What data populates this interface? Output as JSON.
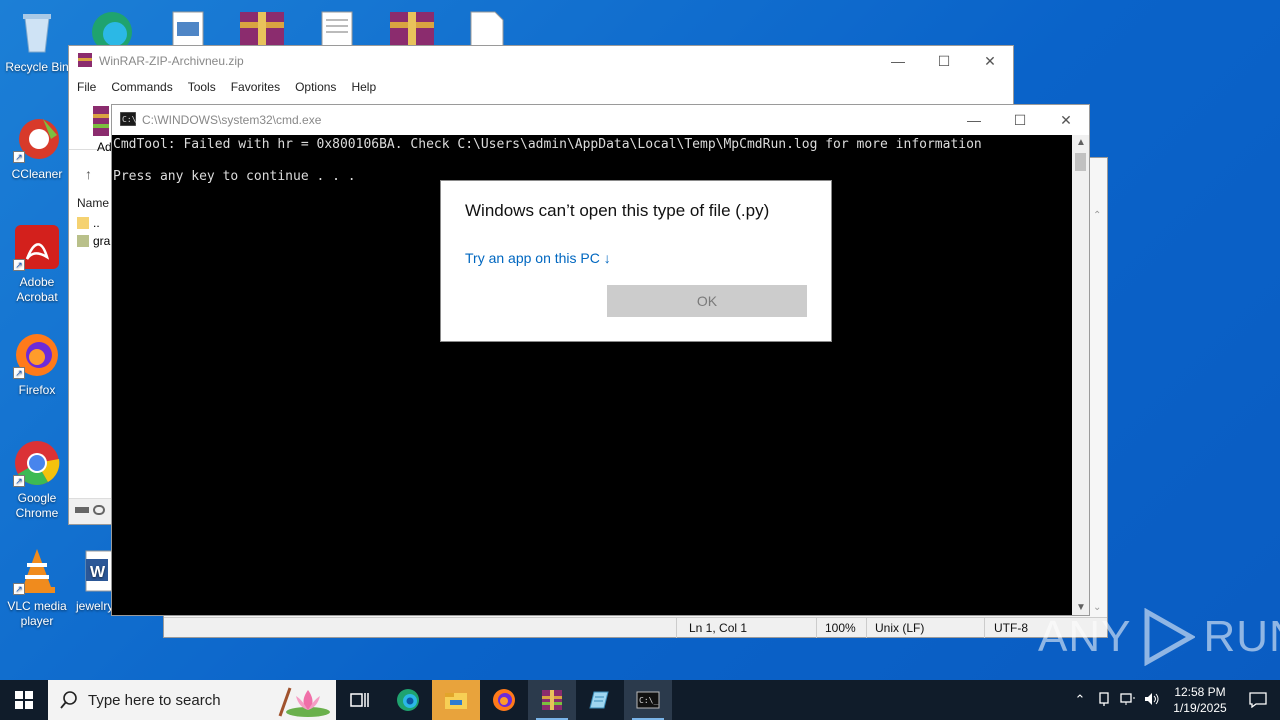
{
  "desktop_icons": [
    {
      "label": "Recycle Bin"
    },
    {
      "label": "CCleaner"
    },
    {
      "label": "Adobe Acrobat"
    },
    {
      "label": "Firefox"
    },
    {
      "label": "Google Chrome"
    },
    {
      "label": "VLC media player"
    },
    {
      "label": "jewelry"
    }
  ],
  "winrar": {
    "title": "WinRAR-ZIP-Archivneu.zip",
    "menu": [
      "File",
      "Commands",
      "Tools",
      "Favorites",
      "Options",
      "Help"
    ],
    "toolbar_label_partial": "Ad",
    "column_name": "Name",
    "rows": [
      "..",
      "gra"
    ]
  },
  "editor": {
    "status": {
      "position": "Ln 1, Col 1",
      "zoom": "100%",
      "line_endings": "Unix (LF)",
      "encoding": "UTF-8"
    }
  },
  "cmd": {
    "title": "C:\\WINDOWS\\system32\\cmd.exe",
    "lines": [
      "CmdTool: Failed with hr = 0x800106BA. Check C:\\Users\\admin\\AppData\\Local\\Temp\\MpCmdRun.log for more information",
      "",
      "Press any key to continue . . ."
    ]
  },
  "dialog": {
    "title": "Windows can’t open this type of file (.py)",
    "link": "Try an app on this PC ↓",
    "ok": "OK"
  },
  "watermark": {
    "left": "ANY",
    "right": "RUN"
  },
  "taskbar": {
    "search_placeholder": "Type here to search",
    "time": "12:58 PM",
    "date": "1/19/2025"
  },
  "colors": {
    "desktop": "#0a63c9",
    "taskbar": "#101c2a",
    "link": "#0067c0",
    "console_bg": "#000000"
  }
}
